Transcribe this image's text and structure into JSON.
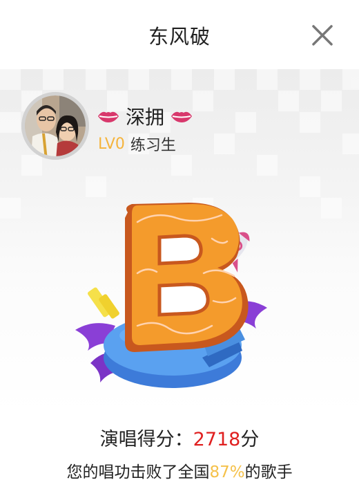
{
  "header": {
    "title": "东风破",
    "close_icon": "close-icon"
  },
  "user": {
    "avatar_icon": "avatar-photo",
    "name": "深拥",
    "decoration_icon": "lips-icon",
    "level_badge": "LV0",
    "level_title": "练习生"
  },
  "result": {
    "grade": "B",
    "grade_art_icons": [
      "grade-letter-b",
      "rocket-icon",
      "pie-base",
      "wing-icon"
    ],
    "score_label": "演唱得分：",
    "score_value": "2718",
    "score_unit": "分",
    "beat_prefix": "您的唱功击败了全国",
    "beat_percent": "87%",
    "beat_suffix": "的歌手"
  },
  "colors": {
    "accent_orange": "#f7a12d",
    "score_red": "#e02020",
    "level_yellow": "#f5b43c",
    "lips_pink": "#d8386c"
  }
}
